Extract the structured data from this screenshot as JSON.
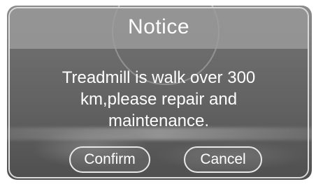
{
  "dialog": {
    "title": "Notice",
    "message_lines": [
      "Treadmill is walk over 300",
      "km,please repair and",
      "maintenance."
    ],
    "buttons": {
      "confirm": "Confirm",
      "cancel": "Cancel"
    }
  }
}
